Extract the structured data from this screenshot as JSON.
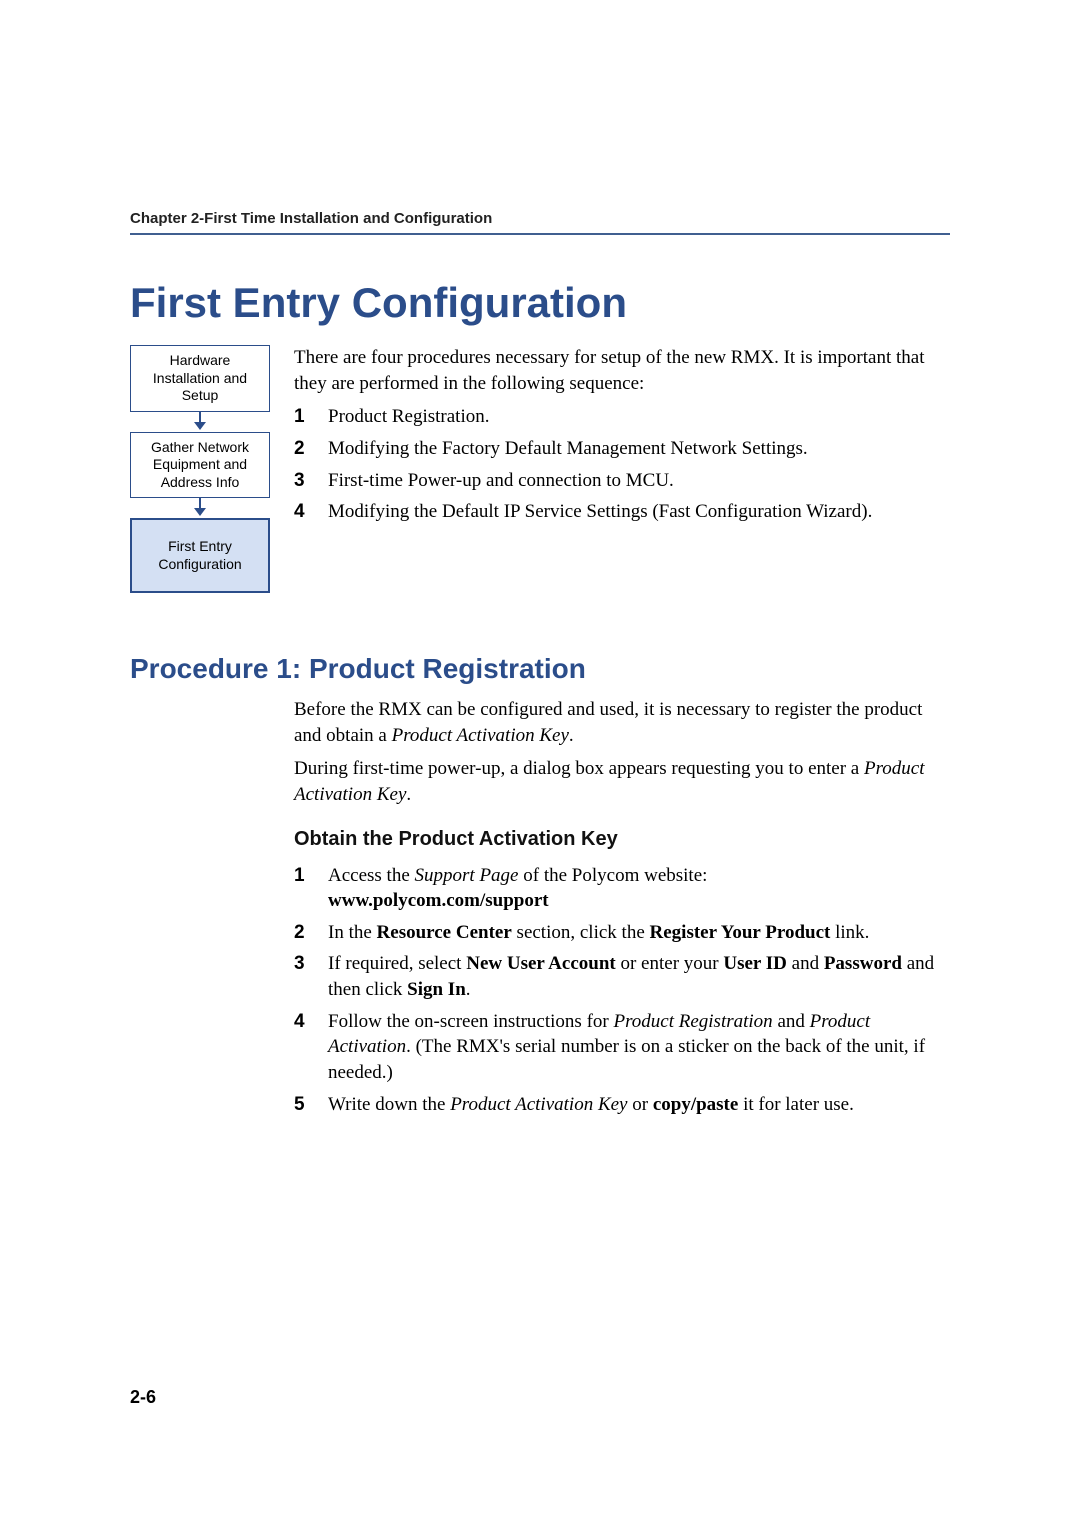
{
  "running_head": "Chapter 2-First Time Installation and Configuration",
  "section_title": "First Entry Configuration",
  "flow": {
    "box1": "Hardware Installation and Setup",
    "box2": "Gather Network Equipment and Address Info",
    "box3": "First Entry Configuration"
  },
  "intro": "There are four procedures necessary for setup of the new RMX. It is important that they are performed in the following sequence:",
  "intro_steps": [
    "Product Registration.",
    "Modifying the Factory Default Management Network Settings.",
    "First-time Power-up and connection to MCU.",
    "Modifying the Default IP Service Settings (Fast Configuration Wizard)."
  ],
  "procedure1_title": "Procedure 1: Product Registration",
  "proc1": {
    "p1_a": "Before the RMX can be configured and used, it is necessary to register the product and obtain a ",
    "p1_key": "Product Activation Key",
    "p1_b": ".",
    "p2_a": "During first-time power-up, a dialog box appears requesting you to enter a ",
    "p2_key": "Product Activation Key",
    "p2_b": "."
  },
  "subhead": "Obtain the Product Activation Key",
  "obtain_steps": {
    "s1_a": "Access the ",
    "s1_i": "Support Page",
    "s1_b": " of the Polycom website:",
    "s1_url": "www.polycom.com/support",
    "s2_a": "In the ",
    "s2_b1": "Resource Center",
    "s2_c": " section, click the ",
    "s2_b2": "Register Your Product",
    "s2_d": " link.",
    "s3_a": "If required, select ",
    "s3_b1": "New User Account",
    "s3_c": " or enter your ",
    "s3_b2": "User ID",
    "s3_d": " and ",
    "s3_b3": "Password",
    "s3_e": " and then click ",
    "s3_b4": "Sign In",
    "s3_f": ".",
    "s4_a": "Follow the on-screen instructions for ",
    "s4_i1": "Product Registration",
    "s4_b": " and ",
    "s4_i2": "Product Activation",
    "s4_c": ". (The RMX's serial number is on a sticker on the back of the unit, if needed.)",
    "s5_a": "Write down the ",
    "s5_i": "Product Activation Key",
    "s5_b": " or ",
    "s5_bold": "copy/paste",
    "s5_c": " it for later use."
  },
  "page_number": "2-6"
}
